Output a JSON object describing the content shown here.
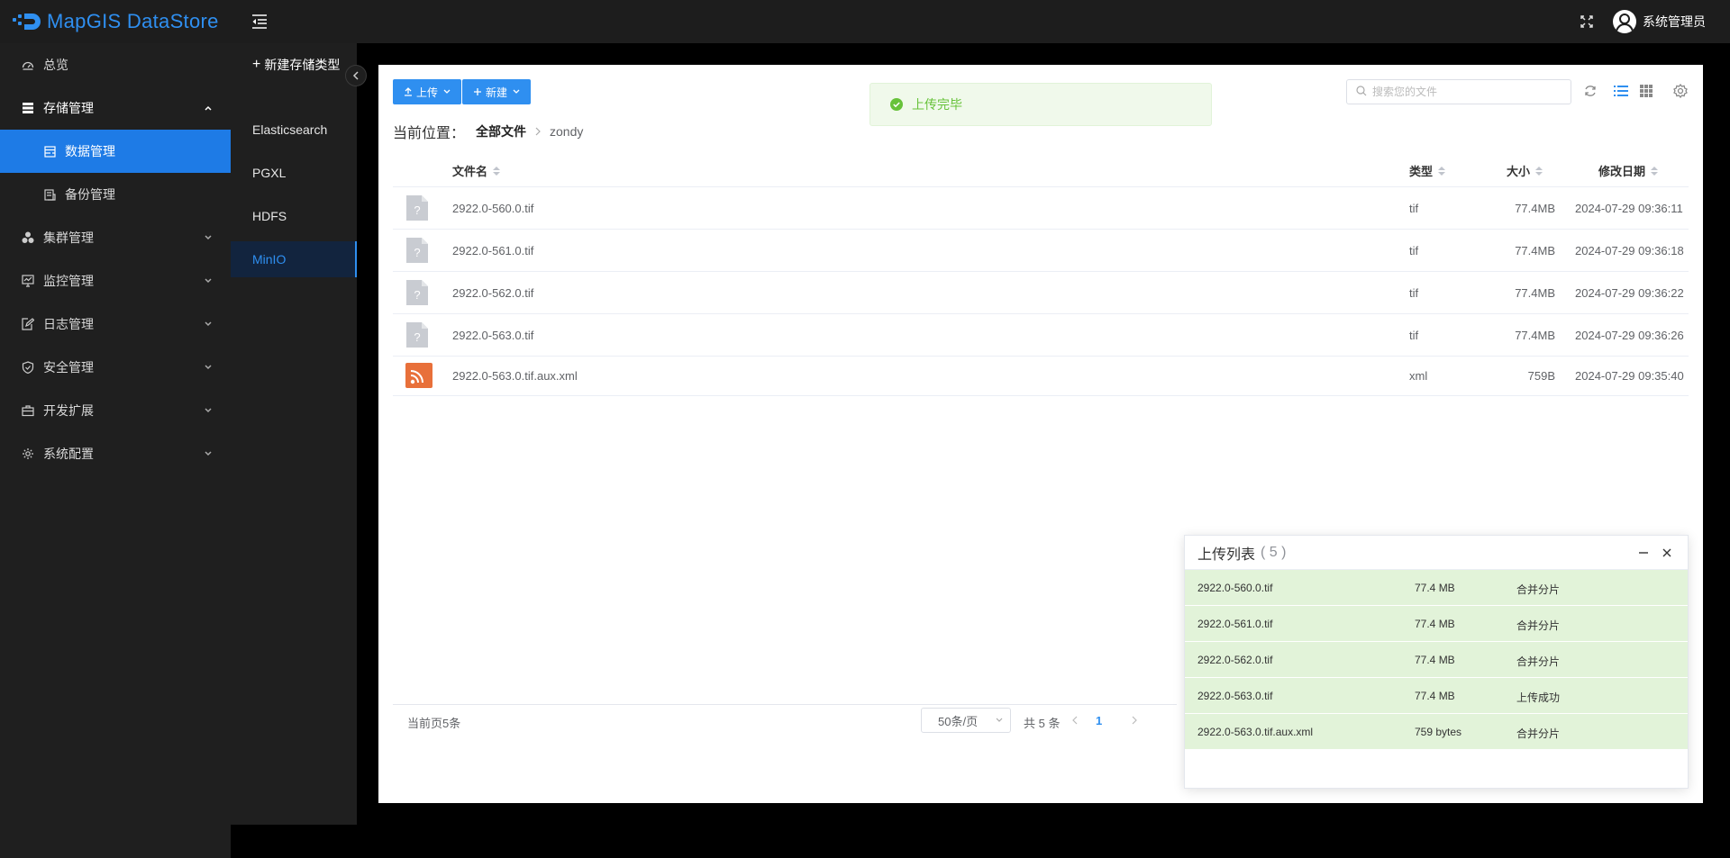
{
  "app": {
    "logo_text": "MapGIS DataStore",
    "user_name": "系统管理员"
  },
  "colors": {
    "primary": "#2f8ff0",
    "sidebar_bg": "#1f1f1f",
    "success": "#67c23a",
    "upload_row": "#e2f3d9"
  },
  "sidebar": {
    "items": [
      {
        "label": "总览",
        "icon": "dashboard-icon"
      },
      {
        "label": "存储管理",
        "icon": "storage-icon",
        "expanded": true
      },
      {
        "label": "数据管理",
        "icon": "data-icon",
        "active": true
      },
      {
        "label": "备份管理",
        "icon": "backup-icon"
      },
      {
        "label": "集群管理",
        "icon": "cluster-icon"
      },
      {
        "label": "监控管理",
        "icon": "monitor-icon"
      },
      {
        "label": "日志管理",
        "icon": "log-icon"
      },
      {
        "label": "安全管理",
        "icon": "shield-icon"
      },
      {
        "label": "开发扩展",
        "icon": "briefcase-icon"
      },
      {
        "label": "系统配置",
        "icon": "gear-icon"
      }
    ]
  },
  "storage_types": {
    "new_label": "新建存储类型",
    "items": [
      {
        "label": "Elasticsearch"
      },
      {
        "label": "PGXL"
      },
      {
        "label": "HDFS"
      },
      {
        "label": "MinIO",
        "active": true
      }
    ]
  },
  "toolbar": {
    "upload_label": "上传",
    "new_label": "新建",
    "search_placeholder": "搜索您的文件"
  },
  "toast": {
    "message": "上传完毕"
  },
  "breadcrumb": {
    "prefix": "当前位置：",
    "root": "全部文件",
    "current": "zondy"
  },
  "table": {
    "columns": {
      "name": "文件名",
      "type": "类型",
      "size": "大小",
      "date": "修改日期"
    },
    "rows": [
      {
        "name": "2922.0-560.0.tif",
        "type": "tif",
        "size": "77.4MB",
        "date": "2024-07-29 09:36:11",
        "icon": "unknown-file-icon"
      },
      {
        "name": "2922.0-561.0.tif",
        "type": "tif",
        "size": "77.4MB",
        "date": "2024-07-29 09:36:18",
        "icon": "unknown-file-icon"
      },
      {
        "name": "2922.0-562.0.tif",
        "type": "tif",
        "size": "77.4MB",
        "date": "2024-07-29 09:36:22",
        "icon": "unknown-file-icon"
      },
      {
        "name": "2922.0-563.0.tif",
        "type": "tif",
        "size": "77.4MB",
        "date": "2024-07-29 09:36:26",
        "icon": "unknown-file-icon"
      },
      {
        "name": "2922.0-563.0.tif.aux.xml",
        "type": "xml",
        "size": "759B",
        "date": "2024-07-29 09:35:40",
        "icon": "xml-file-icon"
      }
    ]
  },
  "pagination": {
    "page_count_label": "当前页5条",
    "page_size": "50条/页",
    "total": "共 5 条",
    "current_page": "1"
  },
  "upload_list": {
    "title": "上传列表",
    "count": "( 5 )",
    "rows": [
      {
        "name": "2922.0-560.0.tif",
        "size": "77.4 MB",
        "status": "合并分片"
      },
      {
        "name": "2922.0-561.0.tif",
        "size": "77.4 MB",
        "status": "合并分片"
      },
      {
        "name": "2922.0-562.0.tif",
        "size": "77.4 MB",
        "status": "合并分片"
      },
      {
        "name": "2922.0-563.0.tif",
        "size": "77.4 MB",
        "status": "上传成功"
      },
      {
        "name": "2922.0-563.0.tif.aux.xml",
        "size": "759 bytes",
        "status": "合并分片"
      }
    ]
  }
}
